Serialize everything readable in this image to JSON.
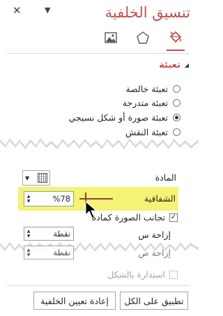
{
  "pane": {
    "title": "تنسيق الخلفية",
    "close_glyph": "✕",
    "menu_glyph": "▼"
  },
  "tabs": [
    {
      "name": "fill",
      "icon": "paint-bucket-icon",
      "selected": true
    },
    {
      "name": "effects",
      "icon": "pentagon-icon",
      "selected": false
    },
    {
      "name": "picture",
      "icon": "picture-icon",
      "selected": false
    }
  ],
  "fill_section": {
    "header": "تعبئة",
    "options": [
      {
        "label": "تعبئة خالصة",
        "selected": false
      },
      {
        "label": "تعبئة متدرجة",
        "selected": false
      },
      {
        "label": "تعبئة صورة أو شكل نسيجي",
        "selected": true
      },
      {
        "label": "تعبئة النقش",
        "selected": false
      }
    ]
  },
  "texture": {
    "label": "المادة"
  },
  "transparency": {
    "label": "الشفافية",
    "value": "%78",
    "fraction": 0.78
  },
  "tile": {
    "label": "تجانب الصورة كمادة",
    "checked": true
  },
  "offset_x": {
    "label": "إزاحة س",
    "value": "نقطة"
  },
  "offset_y": {
    "label": "إزاحة ص",
    "value": "نقطة"
  },
  "rotate": {
    "label": "استدارة بالشكل",
    "checked": false
  },
  "buttons": {
    "apply_all": "تطبيق على الكل",
    "reset": "إعادة تعيين الخلفية"
  },
  "colors": {
    "accent": "#c0504d",
    "highlight": "#f5f376"
  }
}
